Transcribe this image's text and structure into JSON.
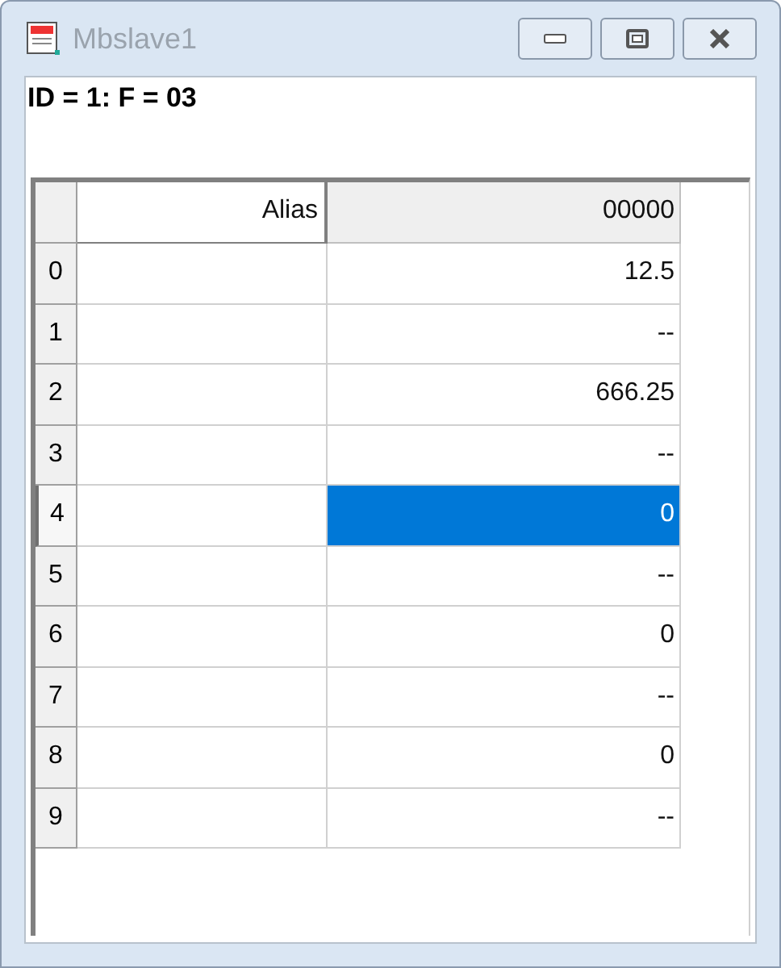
{
  "window": {
    "title": "Mbslave1"
  },
  "status_text": "ID = 1: F = 03",
  "table": {
    "columns": [
      "Alias",
      "00000"
    ],
    "rows": [
      {
        "header": "0",
        "alias": "",
        "value": "12.5",
        "selected": false
      },
      {
        "header": "1",
        "alias": "",
        "value": "--",
        "selected": false
      },
      {
        "header": "2",
        "alias": "",
        "value": "666.25",
        "selected": false
      },
      {
        "header": "3",
        "alias": "",
        "value": "--",
        "selected": false
      },
      {
        "header": "4",
        "alias": "",
        "value": "0",
        "selected": true
      },
      {
        "header": "5",
        "alias": "",
        "value": "--",
        "selected": false
      },
      {
        "header": "6",
        "alias": "",
        "value": "0",
        "selected": false
      },
      {
        "header": "7",
        "alias": "",
        "value": "--",
        "selected": false
      },
      {
        "header": "8",
        "alias": "",
        "value": "0",
        "selected": false
      },
      {
        "header": "9",
        "alias": "",
        "value": "--",
        "selected": false
      }
    ]
  }
}
